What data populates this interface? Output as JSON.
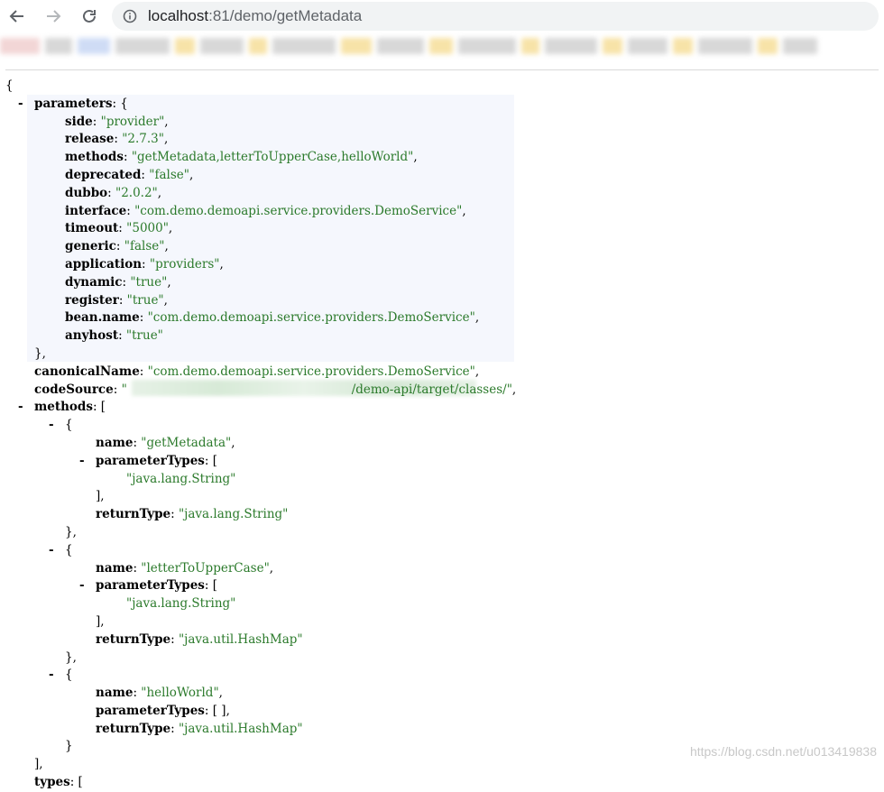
{
  "browser": {
    "url_host": "localhost",
    "url_rest": ":81/demo/getMetadata"
  },
  "json_view": {
    "lines": [
      {
        "indent": 0,
        "toggle": "",
        "key": "",
        "value": "",
        "punct": "{"
      },
      {
        "indent": 1,
        "toggle": "-",
        "key": "parameters",
        "value": "",
        "punct": ": {"
      },
      {
        "indent": 2,
        "toggle": "",
        "key": "side",
        "value": "\"provider\"",
        "punct": ","
      },
      {
        "indent": 2,
        "toggle": "",
        "key": "release",
        "value": "\"2.7.3\"",
        "punct": ","
      },
      {
        "indent": 2,
        "toggle": "",
        "key": "methods",
        "value": "\"getMetadata,letterToUpperCase,helloWorld\"",
        "punct": ","
      },
      {
        "indent": 2,
        "toggle": "",
        "key": "deprecated",
        "value": "\"false\"",
        "punct": ","
      },
      {
        "indent": 2,
        "toggle": "",
        "key": "dubbo",
        "value": "\"2.0.2\"",
        "punct": ","
      },
      {
        "indent": 2,
        "toggle": "",
        "key": "interface",
        "value": "\"com.demo.demoapi.service.providers.DemoService\"",
        "punct": ","
      },
      {
        "indent": 2,
        "toggle": "",
        "key": "timeout",
        "value": "\"5000\"",
        "punct": ","
      },
      {
        "indent": 2,
        "toggle": "",
        "key": "generic",
        "value": "\"false\"",
        "punct": ","
      },
      {
        "indent": 2,
        "toggle": "",
        "key": "application",
        "value": "\"providers\"",
        "punct": ","
      },
      {
        "indent": 2,
        "toggle": "",
        "key": "dynamic",
        "value": "\"true\"",
        "punct": ","
      },
      {
        "indent": 2,
        "toggle": "",
        "key": "register",
        "value": "\"true\"",
        "punct": ","
      },
      {
        "indent": 2,
        "toggle": "",
        "key": "bean.name",
        "value": "\"com.demo.demoapi.service.providers.DemoService\"",
        "punct": ","
      },
      {
        "indent": 2,
        "toggle": "",
        "key": "anyhost",
        "value": "\"true\"",
        "punct": ""
      },
      {
        "indent": 1,
        "toggle": "",
        "key": "",
        "value": "",
        "punct": "},"
      },
      {
        "indent": 1,
        "toggle": "",
        "key": "canonicalName",
        "value": "\"com.demo.demoapi.service.providers.DemoService\"",
        "punct": ","
      },
      {
        "indent": 1,
        "toggle": "",
        "key": "codeSource",
        "value": "\"                                                          /demo-api/target/classes/\"",
        "punct": ","
      },
      {
        "indent": 1,
        "toggle": "-",
        "key": "methods",
        "value": "",
        "punct": ": ["
      },
      {
        "indent": 2,
        "toggle": "-",
        "key": "",
        "value": "",
        "punct": "{"
      },
      {
        "indent": 3,
        "toggle": "",
        "key": "name",
        "value": "\"getMetadata\"",
        "punct": ","
      },
      {
        "indent": 3,
        "toggle": "-",
        "key": "parameterTypes",
        "value": "",
        "punct": ": ["
      },
      {
        "indent": 4,
        "toggle": "",
        "key": "",
        "value": "\"java.lang.String\"",
        "punct": ""
      },
      {
        "indent": 3,
        "toggle": "",
        "key": "",
        "value": "",
        "punct": "],"
      },
      {
        "indent": 3,
        "toggle": "",
        "key": "returnType",
        "value": "\"java.lang.String\"",
        "punct": ""
      },
      {
        "indent": 2,
        "toggle": "",
        "key": "",
        "value": "",
        "punct": "},"
      },
      {
        "indent": 2,
        "toggle": "-",
        "key": "",
        "value": "",
        "punct": "{"
      },
      {
        "indent": 3,
        "toggle": "",
        "key": "name",
        "value": "\"letterToUpperCase\"",
        "punct": ","
      },
      {
        "indent": 3,
        "toggle": "-",
        "key": "parameterTypes",
        "value": "",
        "punct": ": ["
      },
      {
        "indent": 4,
        "toggle": "",
        "key": "",
        "value": "\"java.lang.String\"",
        "punct": ""
      },
      {
        "indent": 3,
        "toggle": "",
        "key": "",
        "value": "",
        "punct": "],"
      },
      {
        "indent": 3,
        "toggle": "",
        "key": "returnType",
        "value": "\"java.util.HashMap\"",
        "punct": ""
      },
      {
        "indent": 2,
        "toggle": "",
        "key": "",
        "value": "",
        "punct": "},"
      },
      {
        "indent": 2,
        "toggle": "-",
        "key": "",
        "value": "",
        "punct": "{"
      },
      {
        "indent": 3,
        "toggle": "",
        "key": "name",
        "value": "\"helloWorld\"",
        "punct": ","
      },
      {
        "indent": 3,
        "toggle": "",
        "key": "parameterTypes",
        "value": "",
        "punct": ": [ ],"
      },
      {
        "indent": 3,
        "toggle": "",
        "key": "returnType",
        "value": "\"java.util.HashMap\"",
        "punct": ""
      },
      {
        "indent": 2,
        "toggle": "",
        "key": "",
        "value": "",
        "punct": "}"
      },
      {
        "indent": 1,
        "toggle": "",
        "key": "",
        "value": "",
        "punct": "],"
      },
      {
        "indent": 1,
        "toggle": "",
        "key": "types",
        "value": "",
        "punct": ": ["
      }
    ]
  },
  "watermark": "https://blog.csdn.net/u013419838",
  "colors": {
    "string": "#2b7a2b",
    "highlight": "#f5f7fd"
  }
}
